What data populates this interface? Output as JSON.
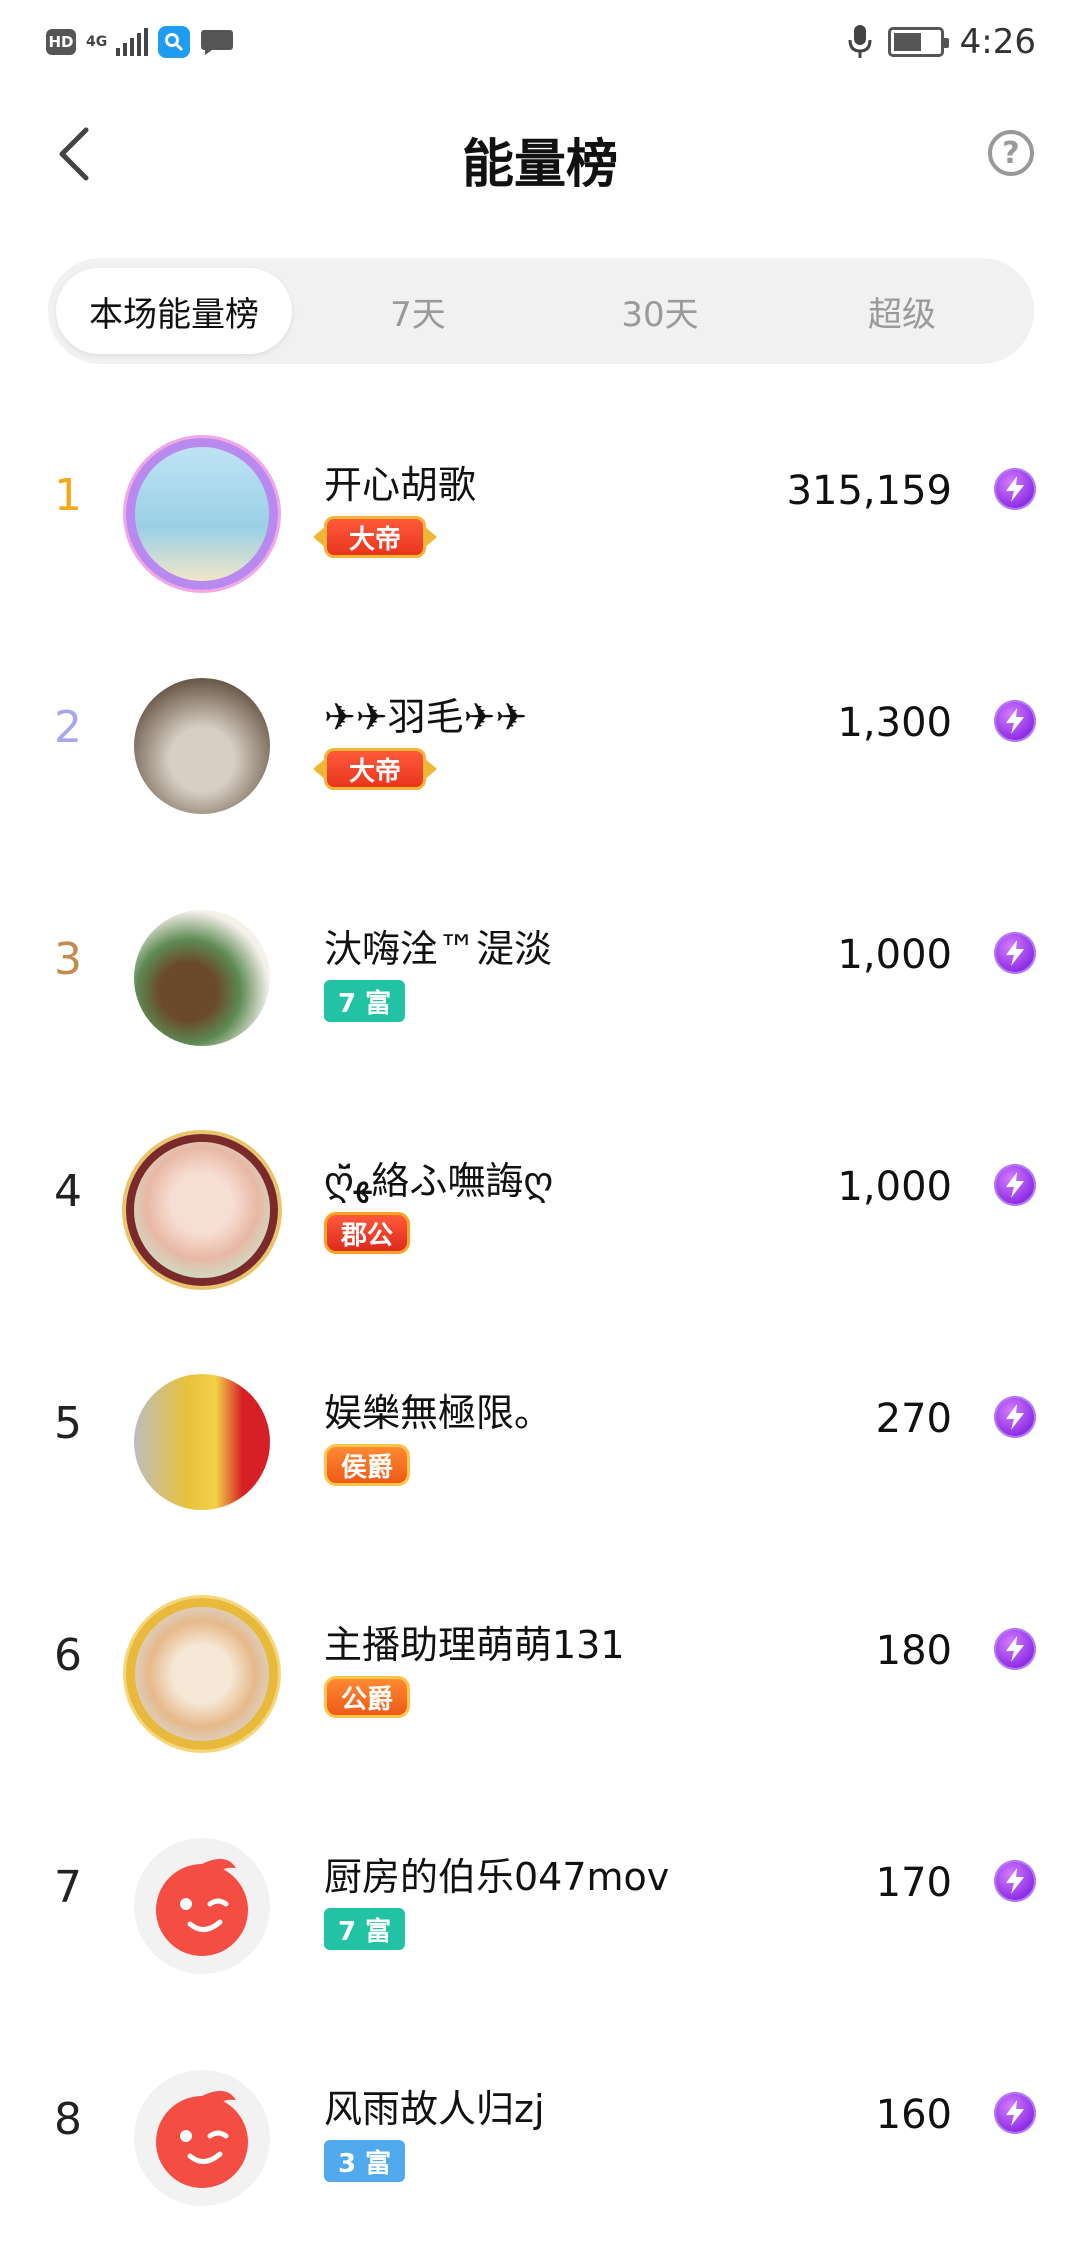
{
  "status_bar": {
    "hd": "HD",
    "network": "4G",
    "time": "4:26"
  },
  "header": {
    "title": "能量榜",
    "help": "?"
  },
  "tabs": [
    {
      "label": "本场能量榜",
      "active": true
    },
    {
      "label": "7天",
      "active": false
    },
    {
      "label": "30天",
      "active": false
    },
    {
      "label": "超级",
      "active": false
    }
  ],
  "colors": {
    "rank1": "#f2a818",
    "rank2": "#a7a7f0",
    "rank3": "#c58a4d",
    "rank_default": "#222222",
    "energy": "#8a2be2"
  },
  "leaderboard": [
    {
      "rank": "1",
      "name": "开心胡歌",
      "badge": "大帝",
      "score": "315,159"
    },
    {
      "rank": "2",
      "name": "✈✈羽毛✈✈",
      "badge": "大帝",
      "score": "1,300"
    },
    {
      "rank": "3",
      "name": "汏嗨洤™湜淡",
      "badge": "7 富",
      "score": "1,000"
    },
    {
      "rank": "4",
      "name": "ღ̆̈ﻬ絡ふ嘸誨ღ",
      "badge": "郡公",
      "score": "1,000"
    },
    {
      "rank": "5",
      "name": "娱樂無極限。",
      "badge": "侯爵",
      "score": "270"
    },
    {
      "rank": "6",
      "name": "主播助理萌萌131",
      "badge": "公爵",
      "score": "180"
    },
    {
      "rank": "7",
      "name": "厨房的伯乐047mov",
      "badge": "7 富",
      "score": "170"
    },
    {
      "rank": "8",
      "name": "风雨故人归zj",
      "badge": "3 富",
      "score": "160"
    }
  ]
}
